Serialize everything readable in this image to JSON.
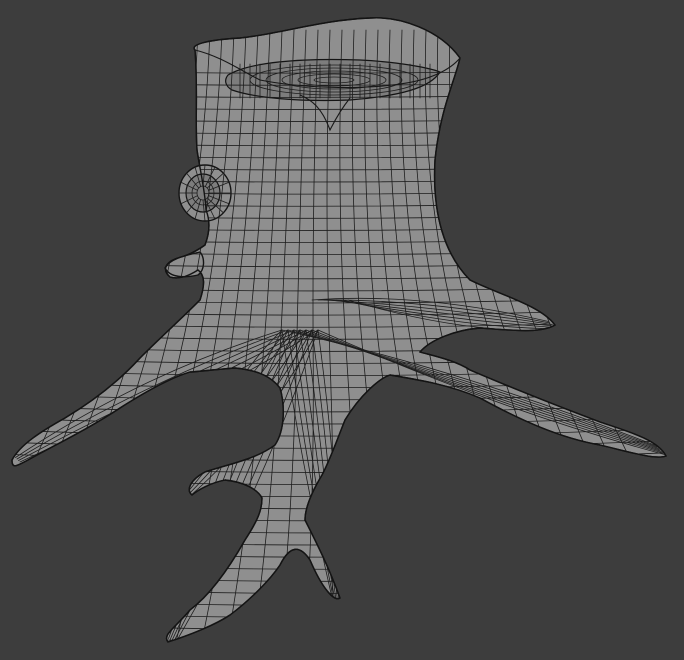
{
  "viewport": {
    "background_color": "#3d3d3d",
    "mesh_color": "#8f8f8f",
    "wire_color": "#1d1d1d",
    "mode": "wireframe",
    "object": "tree-stump"
  }
}
